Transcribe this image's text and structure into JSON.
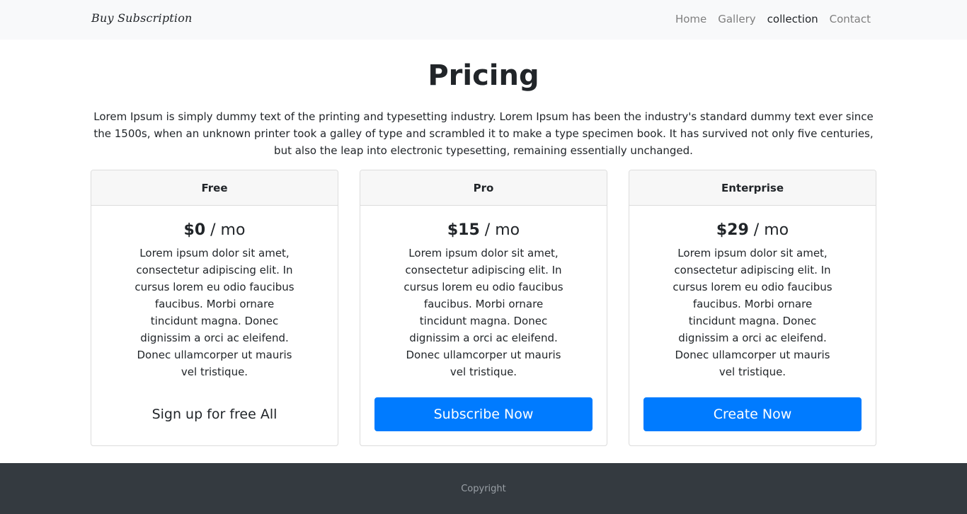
{
  "navbar": {
    "brand": "Buy Subscription",
    "links": [
      {
        "label": "Home"
      },
      {
        "label": "Gallery"
      },
      {
        "label": "collection"
      },
      {
        "label": "Contact"
      }
    ]
  },
  "header": {
    "title": "Pricing",
    "lead": "Lorem Ipsum is simply dummy text of the printing and typesetting industry. Lorem Ipsum has been the industry's standard dummy text ever since the 1500s, when an unknown printer took a galley of type and scrambled it to make a type specimen book. It has survived not only five centuries, but also the leap into electronic typesetting, remaining essentially unchanged."
  },
  "plans": [
    {
      "name": "Free",
      "price": "$0",
      "period": " / mo",
      "description": "Lorem ipsum dolor sit amet, consectetur adipiscing elit. In cursus lorem eu odio faucibus faucibus. Morbi ornare tincidunt magna. Donec dignissim a orci ac eleifend. Donec ullamcorper ut mauris vel tristique.",
      "cta": "Sign up for free All"
    },
    {
      "name": "Pro",
      "price": "$15",
      "period": " / mo",
      "description": "Lorem ipsum dolor sit amet, consectetur adipiscing elit. In cursus lorem eu odio faucibus faucibus. Morbi ornare tincidunt magna. Donec dignissim a orci ac eleifend. Donec ullamcorper ut mauris vel tristique.",
      "cta": "Subscribe Now"
    },
    {
      "name": "Enterprise",
      "price": "$29",
      "period": " / mo",
      "description": "Lorem ipsum dolor sit amet, consectetur adipiscing elit. In cursus lorem eu odio faucibus faucibus. Morbi ornare tincidunt magna. Donec dignissim a orci ac eleifend. Donec ullamcorper ut mauris vel tristique.",
      "cta": "Create Now"
    }
  ],
  "footer": {
    "text": "Copyright"
  },
  "colors": {
    "primary": "#007bff",
    "navbar_bg": "#f8f9fa",
    "footer_bg": "#343a40"
  }
}
